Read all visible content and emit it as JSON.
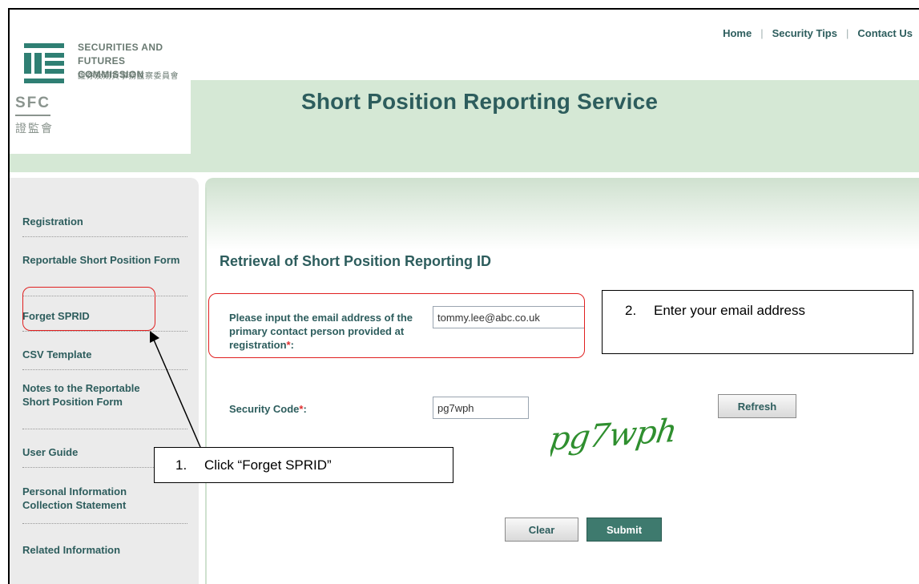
{
  "header": {
    "logo": {
      "name_en_line1": "SECURITIES AND",
      "name_en_line2": "FUTURES COMMISSION",
      "name_cn": "證券及期貨事務監察委員會",
      "abbr": "SFC",
      "abbr_cn": "證監會"
    },
    "links": [
      "Home",
      "Security Tips",
      "Contact Us"
    ],
    "title": "Short Position Reporting Service"
  },
  "sidebar": {
    "items": [
      {
        "label": "Registration"
      },
      {
        "label": "Reportable Short Position Form"
      },
      {
        "label": "Forget SPRID"
      },
      {
        "label": "CSV Template"
      },
      {
        "label": "Notes to the Reportable Short Position Form"
      },
      {
        "label": "User Guide"
      },
      {
        "label": "Personal Information Collection Statement"
      },
      {
        "label": "Related Information"
      }
    ]
  },
  "form": {
    "heading": "Retrieval of Short Position Reporting ID",
    "email_label": "Please input the email address of the primary contact person provided at registration",
    "email_value": "tommy.lee@abc.co.uk",
    "security_label": "Security Code",
    "security_value": "pg7wph",
    "captcha_text": "pg7wph",
    "required_mark": "*",
    "label_colon": ":",
    "refresh_label": "Refresh",
    "clear_label": "Clear",
    "submit_label": "Submit"
  },
  "annotations": {
    "step1_num": "1.",
    "step1_text": "Click “Forget SPRID”",
    "step2_num": "2.",
    "step2_text": "Enter your email address"
  },
  "colors": {
    "brand_text": "#2d5d5d",
    "header_band": "#d5e8d5",
    "annotation_red": "#e02020",
    "submit_bg": "#3e7a6e",
    "captcha_green": "#2f8f2f"
  }
}
